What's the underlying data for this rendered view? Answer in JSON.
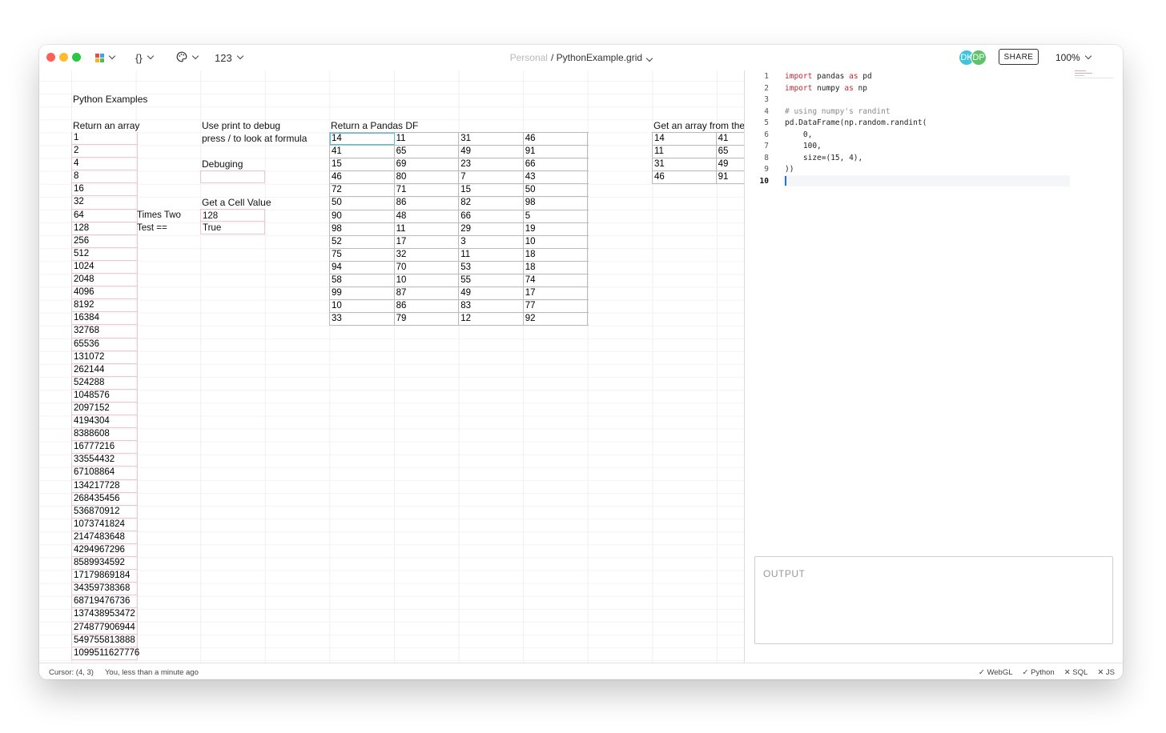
{
  "titlebar": {
    "workspace": "Personal",
    "filename": "/ PythonExample.grid",
    "format_button": "123",
    "share_label": "SHARE",
    "zoom": "100%",
    "avatars": [
      {
        "initials": "DK",
        "color": "#3ec4dc"
      },
      {
        "initials": "DP",
        "color": "#5dc26a"
      }
    ]
  },
  "sheet": {
    "title": "Python Examples",
    "array_section": {
      "header": "Return an array",
      "values": [
        "1",
        "2",
        "4",
        "8",
        "16",
        "32",
        "64",
        "128",
        "256",
        "512",
        "1024",
        "2048",
        "4096",
        "8192",
        "16384",
        "32768",
        "65536",
        "131072",
        "262144",
        "524288",
        "1048576",
        "2097152",
        "4194304",
        "8388608",
        "16777216",
        "33554432",
        "67108864",
        "134217728",
        "268435456",
        "536870912",
        "1073741824",
        "2147483648",
        "4294967296",
        "8589934592",
        "17179869184",
        "34359738368",
        "68719476736",
        "137438953472",
        "274877906944",
        "549755813888",
        "1099511627776"
      ]
    },
    "side_labels": {
      "times_two": "Times Two",
      "test_eq": "Test =="
    },
    "debug_section": {
      "header": "Use print to debug",
      "hint": "press / to look at formula",
      "debugging_label": "Debuging",
      "debugging_value": "",
      "cell_value_header": "Get a Cell Value",
      "cell_value": "128",
      "test_result": "True"
    },
    "df_section": {
      "header": "Return a Pandas DF",
      "rows": [
        [
          "14",
          "11",
          "31",
          "46"
        ],
        [
          "41",
          "65",
          "49",
          "91"
        ],
        [
          "15",
          "69",
          "23",
          "66"
        ],
        [
          "46",
          "80",
          "7",
          "43"
        ],
        [
          "72",
          "71",
          "15",
          "50"
        ],
        [
          "50",
          "86",
          "82",
          "98"
        ],
        [
          "90",
          "48",
          "66",
          "5"
        ],
        [
          "98",
          "11",
          "29",
          "19"
        ],
        [
          "52",
          "17",
          "3",
          "10"
        ],
        [
          "75",
          "32",
          "11",
          "18"
        ],
        [
          "94",
          "70",
          "53",
          "18"
        ],
        [
          "58",
          "10",
          "55",
          "74"
        ],
        [
          "99",
          "87",
          "49",
          "17"
        ],
        [
          "10",
          "86",
          "83",
          "77"
        ],
        [
          "33",
          "79",
          "12",
          "92"
        ]
      ]
    },
    "get_array_section": {
      "header": "Get an array from the",
      "rows": [
        [
          "14",
          "41"
        ],
        [
          "11",
          "65"
        ],
        [
          "31",
          "49"
        ],
        [
          "46",
          "91"
        ]
      ]
    }
  },
  "editor": {
    "lines": [
      {
        "n": "1",
        "tokens": [
          {
            "t": "import",
            "c": "kw"
          },
          {
            "t": " pandas ",
            "c": ""
          },
          {
            "t": "as",
            "c": "kw"
          },
          {
            "t": " pd",
            "c": ""
          }
        ]
      },
      {
        "n": "2",
        "tokens": [
          {
            "t": "import",
            "c": "kw"
          },
          {
            "t": " numpy ",
            "c": ""
          },
          {
            "t": "as",
            "c": "kw"
          },
          {
            "t": " np",
            "c": ""
          }
        ]
      },
      {
        "n": "3",
        "tokens": []
      },
      {
        "n": "4",
        "tokens": [
          {
            "t": "# using numpy's randint",
            "c": "cm"
          }
        ]
      },
      {
        "n": "5",
        "tokens": [
          {
            "t": "pd.DataFrame(np.random.randint(",
            "c": ""
          }
        ]
      },
      {
        "n": "6",
        "tokens": [
          {
            "t": "    0,",
            "c": ""
          }
        ]
      },
      {
        "n": "7",
        "tokens": [
          {
            "t": "    100,",
            "c": ""
          }
        ]
      },
      {
        "n": "8",
        "tokens": [
          {
            "t": "    size=(15, 4),",
            "c": ""
          }
        ]
      },
      {
        "n": "9",
        "tokens": [
          {
            "t": "))",
            "c": ""
          }
        ]
      },
      {
        "n": "10",
        "tokens": []
      }
    ],
    "output_label": "OUTPUT"
  },
  "status": {
    "cursor": "Cursor: (4, 3)",
    "saved": "You, less than a minute ago",
    "flags": [
      "✓ WebGL",
      "✓ Python",
      "✕ SQL",
      "✕ JS"
    ]
  }
}
